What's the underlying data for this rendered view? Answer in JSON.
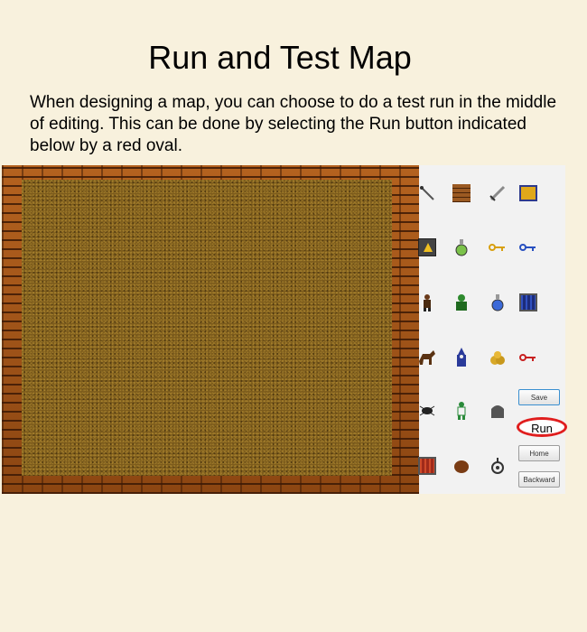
{
  "page": {
    "title": "Run and Test Map",
    "description": "When designing a map, you can choose to do a test run in the middle of editing. This can be done by selecting the Run button indicated below by a red oval."
  },
  "palette": {
    "tiles": [
      {
        "icon": "arrow-icon"
      },
      {
        "icon": "brick-wall-icon"
      },
      {
        "icon": "sword-icon"
      },
      {
        "icon": "treasure-chest-icon"
      },
      {
        "icon": "up-stairs-icon"
      },
      {
        "icon": "green-potion-icon"
      },
      {
        "icon": "gold-key-icon"
      },
      {
        "icon": "blue-key-icon"
      },
      {
        "icon": "hero-icon"
      },
      {
        "icon": "green-goblin-icon"
      },
      {
        "icon": "blue-potion-icon"
      },
      {
        "icon": "blue-door-icon"
      },
      {
        "icon": "horse-icon"
      },
      {
        "icon": "wizard-icon"
      },
      {
        "icon": "gold-pile-icon"
      },
      {
        "icon": "red-key-icon"
      },
      {
        "icon": "spider-icon"
      },
      {
        "icon": "elf-icon"
      },
      {
        "icon": "tombstone-icon"
      },
      {
        "icon": "red-door-icon"
      },
      {
        "icon": "boulder-icon"
      },
      {
        "icon": "bomb-icon"
      }
    ],
    "buttons": {
      "save": "Save",
      "run": "Run",
      "home": "Home",
      "backward": "Backward"
    }
  },
  "colors": {
    "background": "#f8f1dd",
    "highlight_oval": "#e01e1e"
  }
}
